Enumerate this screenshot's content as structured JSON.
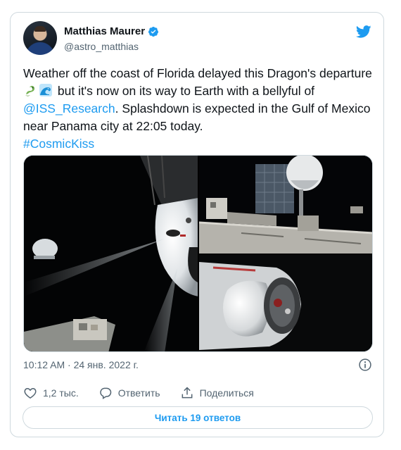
{
  "author": {
    "name": "Matthias Maurer",
    "handle": "@astro_matthias"
  },
  "tweet": {
    "text_part1": "Weather off the coast of Florida delayed this Dragon's departure ",
    "text_part2": " but it's now on its way to Earth with a bellyful of ",
    "mention": "@ISS_Research",
    "text_part3": ". Splashdown is expected in the Gulf of Mexico near Panama city at 22:05 today.",
    "hashtag": "#CosmicKiss",
    "emojis": [
      "dragon-emoji",
      "water-wave-emoji"
    ]
  },
  "timestamp": "10:12 AM · 24 янв. 2022 г.",
  "actions": {
    "likes": "1,2 тыс.",
    "reply_label": "Ответить",
    "share_label": "Поделиться"
  },
  "read_replies_label": "Читать 19 ответов",
  "colors": {
    "accent": "#1d9bf0",
    "text": "#0f1419",
    "secondary": "#536471",
    "border": "#cfd9de"
  },
  "icons": [
    "verified-badge-icon",
    "twitter-bird-icon",
    "info-icon",
    "heart-icon",
    "reply-icon",
    "share-icon"
  ]
}
